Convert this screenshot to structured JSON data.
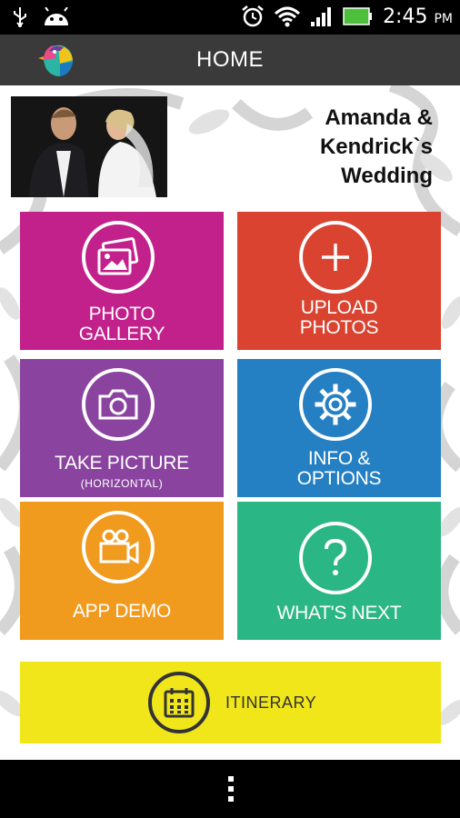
{
  "status_bar": {
    "time": "2:45",
    "ampm": "PM",
    "icons": [
      "usb-icon",
      "android-icon",
      "alarm-icon",
      "wifi-icon",
      "signal-icon",
      "battery-icon"
    ]
  },
  "app_bar": {
    "title": "HOME",
    "logo": "app-logo-bird"
  },
  "header": {
    "title_lines": [
      "Amanda &",
      "Kendrick`s",
      "Wedding"
    ]
  },
  "tiles": [
    {
      "id": "photo-gallery",
      "lines": [
        "PHOTO",
        "GALLERY"
      ],
      "color": "#c2208a",
      "icon": "photos-icon"
    },
    {
      "id": "upload-photos",
      "lines": [
        "UPLOAD",
        "PHOTOS"
      ],
      "color": "#d9432f",
      "icon": "plus-icon"
    },
    {
      "id": "take-picture",
      "lines": [
        "TAKE PICTURE"
      ],
      "sub": "(HORIZONTAL)",
      "color": "#8a44a0",
      "icon": "camera-icon"
    },
    {
      "id": "info-options",
      "lines": [
        "INFO &",
        "OPTIONS"
      ],
      "color": "#2580c3",
      "icon": "gear-icon"
    },
    {
      "id": "app-demo",
      "lines": [
        "APP DEMO"
      ],
      "color": "#f09a1e",
      "icon": "video-camera-icon"
    },
    {
      "id": "whats-next",
      "lines": [
        "WHAT'S NEXT"
      ],
      "color": "#2bb785",
      "icon": "question-icon"
    }
  ],
  "itinerary": {
    "label": "ITINERARY",
    "color": "#f0e61a",
    "icon": "calendar-icon"
  },
  "nav_bar": {
    "icon": "menu-dots-icon"
  }
}
